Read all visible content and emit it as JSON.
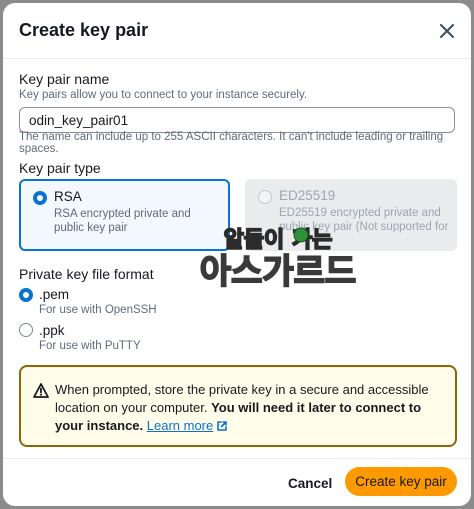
{
  "modal": {
    "title": "Create key pair",
    "close_icon": "close-icon"
  },
  "key_pair_name": {
    "label": "Key pair name",
    "description": "Key pairs allow you to connect to your instance securely.",
    "value": "odin_key_pair01",
    "constraint": "The name can include up to 255 ASCII characters. It can't include leading or trailing spaces."
  },
  "key_pair_type": {
    "label": "Key pair type",
    "options": [
      {
        "title": "RSA",
        "description": "RSA encrypted private and public key pair",
        "selected": true,
        "disabled": false
      },
      {
        "title": "ED25519",
        "description": "ED25519 encrypted private and public key pair (Not supported for Windows",
        "selected": false,
        "disabled": true
      }
    ]
  },
  "file_format": {
    "label": "Private key file format",
    "options": [
      {
        "title": ".pem",
        "description": "For use with OpenSSH",
        "selected": true
      },
      {
        "title": ".ppk",
        "description": "For use with PuTTY",
        "selected": false
      }
    ]
  },
  "alert": {
    "icon": "warning-icon",
    "text_plain": "When prompted, store the private key in a secure and accessible location on your computer. ",
    "text_bold": "You will need it later to connect to your instance.",
    "link_text": "Learn more",
    "link_icon": "external-link-icon"
  },
  "footer": {
    "cancel_label": "Cancel",
    "submit_label": "Create key pair"
  },
  "colors": {
    "primary": "#ff9900",
    "link": "#0972d3",
    "warning_border": "#8d6605",
    "warning_bg": "#fffce9"
  },
  "watermark": "알들이 가는 아스가르드"
}
